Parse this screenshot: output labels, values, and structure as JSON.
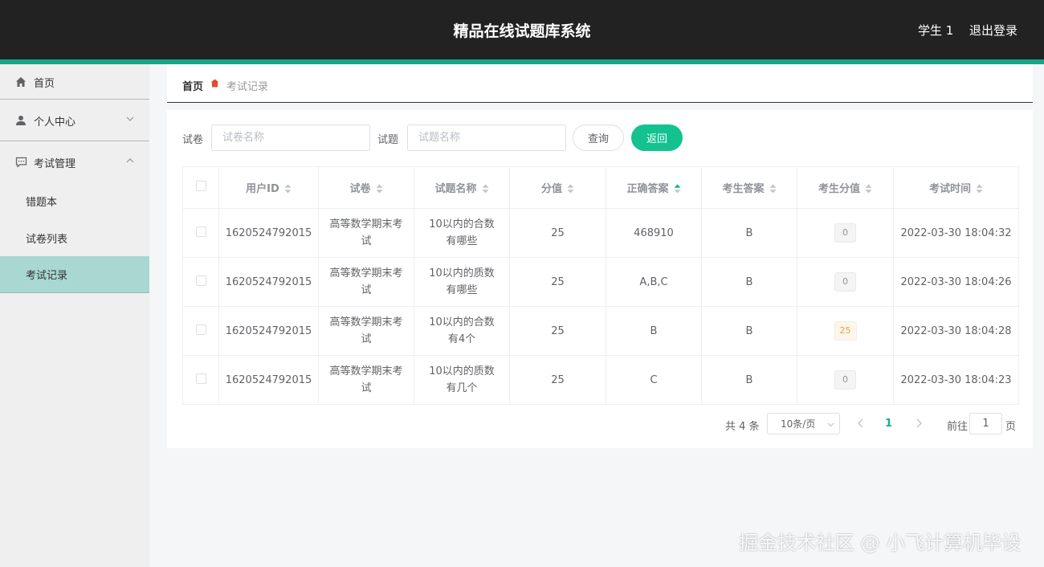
{
  "header": {
    "title": "精品在线试题库系统",
    "user": "学生 1",
    "logout": "退出登录"
  },
  "sidebar": {
    "home": "首页",
    "personal": "个人中心",
    "exam_mgmt": "考试管理",
    "sub_items": [
      "错题本",
      "试卷列表",
      "考试记录"
    ]
  },
  "breadcrumb": {
    "home": "首页",
    "current": "考试记录"
  },
  "search": {
    "paper_label": "试卷",
    "paper_placeholder": "试卷名称",
    "question_label": "试题",
    "question_placeholder": "试题名称",
    "query_btn": "查询",
    "back_btn": "返回"
  },
  "table": {
    "columns": [
      "用户ID",
      "试卷",
      "试题名称",
      "分值",
      "正确答案",
      "考生答案",
      "考生分值",
      "考试时间"
    ],
    "rows": [
      {
        "user_id": "1620524792015",
        "paper": "高等数学期末考试",
        "question": "10以内的合数有哪些",
        "score": "25",
        "answer": "468910",
        "student_answer": "B",
        "student_score": "0",
        "time": "2022-03-30 18:04:32"
      },
      {
        "user_id": "1620524792015",
        "paper": "高等数学期末考试",
        "question": "10以内的质数有哪些",
        "score": "25",
        "answer": "A,B,C",
        "student_answer": "B",
        "student_score": "0",
        "time": "2022-03-30 18:04:26"
      },
      {
        "user_id": "1620524792015",
        "paper": "高等数学期末考试",
        "question": "10以内的合数有4个",
        "score": "25",
        "answer": "B",
        "student_answer": "B",
        "student_score": "25",
        "time": "2022-03-30 18:04:28"
      },
      {
        "user_id": "1620524792015",
        "paper": "高等数学期末考试",
        "question": "10以内的质数有几个",
        "score": "25",
        "answer": "C",
        "student_answer": "B",
        "student_score": "0",
        "time": "2022-03-30 18:04:23"
      }
    ]
  },
  "pagination": {
    "total": "共 4 条",
    "page_size": "10条/页",
    "current_page": "1",
    "goto_label": "前往",
    "goto_value": "1",
    "page_suffix": "页"
  },
  "watermark": "掘金技术社区 @ 小飞计算机毕设",
  "colors": {
    "topbar": "#222222",
    "accent": "#18a58a",
    "primary_button": "#13c28f",
    "active_menu": "#a9d7d1"
  }
}
